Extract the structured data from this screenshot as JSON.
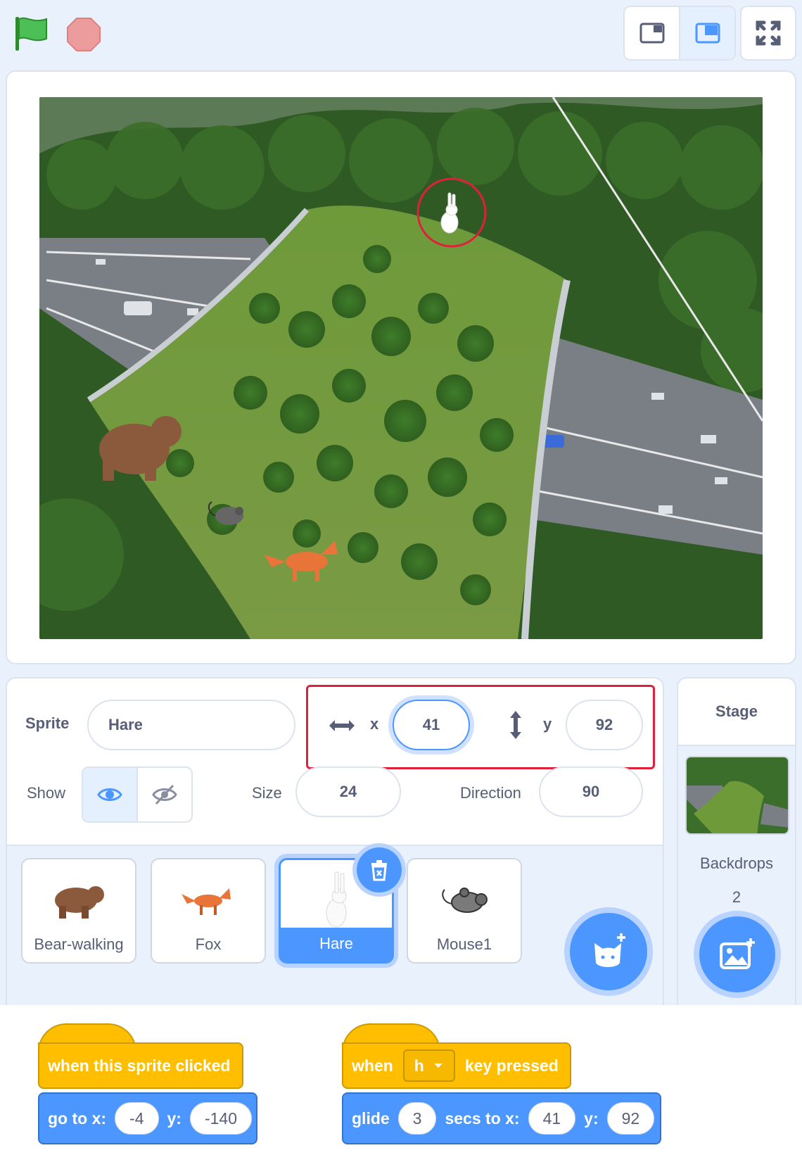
{
  "toolbar": {
    "flag_icon": "green-flag-icon",
    "stop_icon": "stop-icon",
    "layout_icons": [
      "small-stage-icon",
      "normal-stage-icon"
    ],
    "fullscreen_icon": "fullscreen-icon"
  },
  "sprite_info": {
    "sprite_label": "Sprite",
    "sprite_name": "Hare",
    "x_label": "x",
    "x_value": "41",
    "y_label": "y",
    "y_value": "92",
    "show_label": "Show",
    "size_label": "Size",
    "size_value": "24",
    "direction_label": "Direction",
    "direction_value": "90"
  },
  "sprites": [
    {
      "name": "Bear-walking",
      "icon": "bear-icon"
    },
    {
      "name": "Fox",
      "icon": "fox-icon"
    },
    {
      "name": "Hare",
      "icon": "hare-icon",
      "selected": true
    },
    {
      "name": "Mouse1",
      "icon": "mouse-icon"
    }
  ],
  "stage_panel": {
    "title": "Stage",
    "backdrops_label": "Backdrops",
    "backdrops_count": "2"
  },
  "scripts": [
    {
      "hat": "when this sprite clicked",
      "block": {
        "label": "go to x:",
        "x": "-4",
        "y_label": "y:",
        "y": "-140"
      }
    },
    {
      "hat_prefix": "when",
      "hat_key": "h",
      "hat_suffix": "key pressed",
      "block": {
        "label": "glide",
        "secs": "3",
        "secs_label": "secs to x:",
        "x": "41",
        "y_label": "y:",
        "y": "92"
      }
    }
  ],
  "colors": {
    "accent": "#4c97ff",
    "events": "#ffbf00",
    "highlight": "#e0203a",
    "background": "#e9f1fc"
  }
}
